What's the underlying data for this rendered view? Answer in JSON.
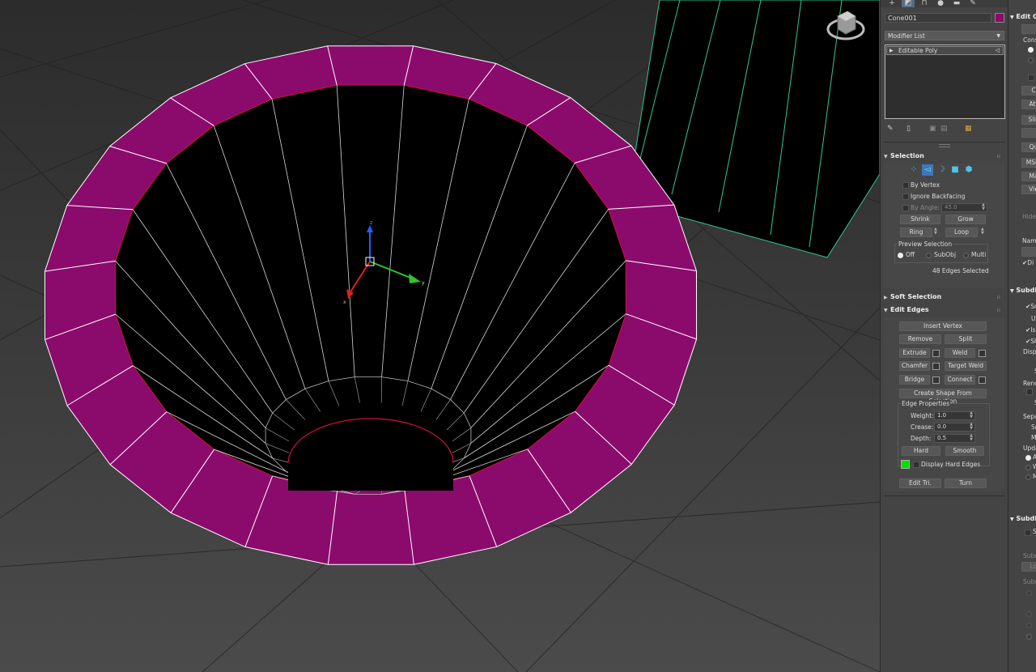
{
  "command_panel": {
    "tabs": [
      "create-icon",
      "modify-icon",
      "hierarchy-icon",
      "motion-icon",
      "display-icon",
      "utilities-icon"
    ],
    "object_name": "Cone001",
    "object_color": "#8b0b6d",
    "modifier_list_label": "Modifier List",
    "stack_item": "Editable Poly",
    "stack_toolbar_icons": [
      "pin-stack-icon",
      "show-end-result-icon",
      "make-unique-icon",
      "remove-modifier-icon",
      "configure-modifier-sets-icon"
    ]
  },
  "selection": {
    "title": "Selection",
    "by_vertex_label": "By Vertex",
    "ignore_backfacing_label": "Ignore Backfacing",
    "by_angle_label": "By Angle:",
    "by_angle_value": "45.0",
    "shrink_label": "Shrink",
    "grow_label": "Grow",
    "ring_label": "Ring",
    "loop_label": "Loop",
    "preview_selection_label": "Preview Selection",
    "preview_options": [
      "Off",
      "SubObj",
      "Multi"
    ],
    "status_text": "48 Edges Selected"
  },
  "soft_selection": {
    "title": "Soft Selection"
  },
  "edit_edges": {
    "title": "Edit Edges",
    "insert_vertex_label": "Insert Vertex",
    "remove_label": "Remove",
    "split_label": "Split",
    "extrude_label": "Extrude",
    "weld_label": "Weld",
    "chamfer_label": "Chamfer",
    "target_weld_label": "Target Weld",
    "bridge_label": "Bridge",
    "connect_label": "Connect",
    "create_shape_label": "Create Shape From Selection",
    "edge_properties_label": "Edge Properties",
    "weight_label": "Weight:",
    "weight_value": "1.0",
    "crease_label": "Crease:",
    "crease_value": "0.0",
    "depth_label": "Depth:",
    "depth_value": "0.5",
    "hard_label": "Hard",
    "smooth_label": "Smooth",
    "display_hard_edges_label": "Display Hard Edges",
    "hard_edge_color": "#00e000",
    "edit_tri_label": "Edit Tri.",
    "turn_label": "Turn"
  },
  "right_panel": {
    "edit_geometry_title": "Edit G",
    "items": [
      "Cons",
      "C",
      "Att",
      "Slic",
      "Qu",
      "MSm",
      "Ma",
      "Vie",
      "Hide",
      "Name",
      "Di"
    ],
    "subdivision_surface_title": "Subdi",
    "subdiv_items": [
      "Sm",
      "Us",
      "Is",
      "Sh",
      "Displ",
      "S",
      "Rend",
      "S",
      "Sepa",
      "Sm",
      "M",
      "Upda",
      "A",
      "W",
      "M"
    ],
    "subdivision_displacement_title": "Subdi",
    "displacement_items": [
      "Su",
      "Subd",
      "Lo",
      "Subd"
    ]
  },
  "viewport": {
    "mesh_color": "#8b0b6d",
    "edge_color": "#ffffff",
    "selected_edge_color": "#d0103a",
    "border_edge_color": "#33c69a",
    "viewcube_icon": "viewcube-icon",
    "gizmo_icon": "transform-gizmo-icon"
  }
}
